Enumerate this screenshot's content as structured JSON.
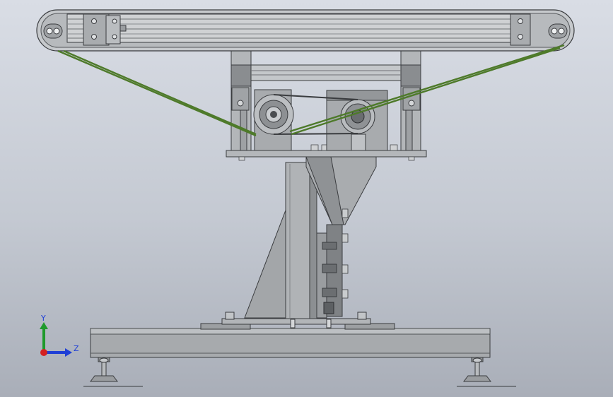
{
  "viewport": {
    "background_top": "#d9dde5",
    "background_bottom": "#a9aeb8"
  },
  "colors": {
    "steel": "#a9acaf",
    "steel_dark": "#6f7275",
    "outline": "#3a3c3f",
    "belt": "#4e7a2a",
    "axis_y": "#1f9a2b",
    "axis_z": "#1f3fd6",
    "axis_x": "#d42121"
  },
  "model": {
    "name": "belt-conveyor-assembly",
    "parts": [
      "conveyor-frame",
      "end-pulley-left",
      "end-pulley-right",
      "drive-belt",
      "motor-pulley",
      "gearbox",
      "mounting-plate",
      "support-column",
      "gusset-plate",
      "base-frame",
      "leveling-foot-left",
      "leveling-foot-right"
    ]
  },
  "triad": {
    "y_label": "Y",
    "z_label": "Z",
    "x_icon": "x-axis-dot-icon"
  }
}
